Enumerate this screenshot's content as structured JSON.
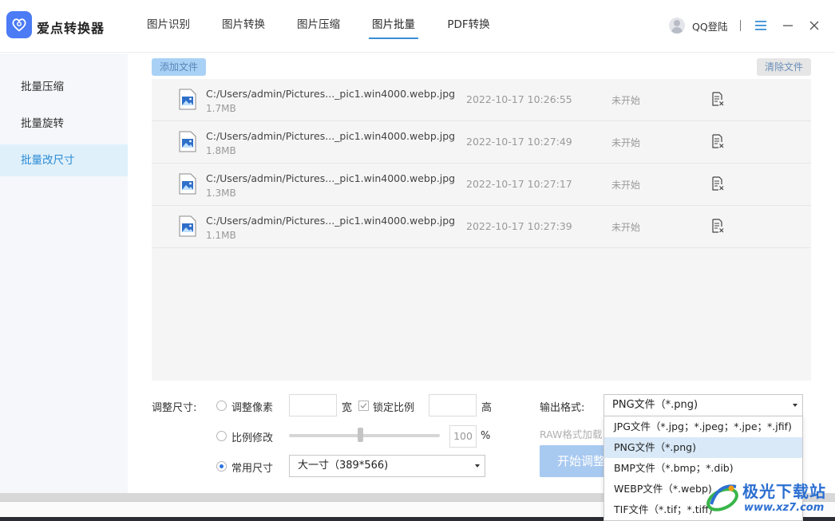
{
  "app": {
    "title": "爱点转换器"
  },
  "nav": {
    "tabs": [
      {
        "label": "图片识别"
      },
      {
        "label": "图片转换"
      },
      {
        "label": "图片压缩"
      },
      {
        "label": "图片批量",
        "active": true
      },
      {
        "label": "PDF转换"
      }
    ]
  },
  "header": {
    "login_label": "QQ登陆"
  },
  "sidebar": {
    "items": [
      {
        "label": "批量压缩"
      },
      {
        "label": "批量旋转"
      },
      {
        "label": "批量改尺寸",
        "active": true
      }
    ]
  },
  "toolbar": {
    "add_file": "添加文件",
    "clear_file": "清除文件"
  },
  "files": [
    {
      "path": "C:/Users/admin/Pictures..._pic1.win4000.webp.jpg",
      "size": "1.7MB",
      "date": "2022-10-17 10:26:55",
      "status": "未开始"
    },
    {
      "path": "C:/Users/admin/Pictures..._pic1.win4000.webp.jpg",
      "size": "1.8MB",
      "date": "2022-10-17 10:27:49",
      "status": "未开始"
    },
    {
      "path": "C:/Users/admin/Pictures..._pic1.win4000.webp.jpg",
      "size": "1.3MB",
      "date": "2022-10-17 10:27:17",
      "status": "未开始"
    },
    {
      "path": "C:/Users/admin/Pictures..._pic1.win4000.webp.jpg",
      "size": "1.1MB",
      "date": "2022-10-17 10:27:39",
      "status": "未开始"
    }
  ],
  "resize": {
    "label": "调整尺寸:",
    "option_pixels": "调整像素",
    "width_label": "宽",
    "lock_ratio": "锁定比例",
    "height_label": "高",
    "option_ratio": "比例修改",
    "ratio_value": "100",
    "percent": "%",
    "ratio_level": 100,
    "option_common": "常用尺寸",
    "common_value": "大一寸（389*566)"
  },
  "output": {
    "label": "输出格式:",
    "selected": "PNG文件（*.png)",
    "raw_hint": "RAW格式加载",
    "start_button": "开始调整",
    "options": [
      "JPG文件（*.jpg；*.jpeg；*.jpe；*.jfif)",
      "PNG文件（*.png)",
      "BMP文件（*.bmp；*.dib)",
      "WEBP文件（*.webp)",
      "TIF文件（*.tif；*.tiff)"
    ],
    "selected_index": 1
  },
  "watermark": {
    "title": "极光下载站",
    "url": "www.xz7.com"
  }
}
